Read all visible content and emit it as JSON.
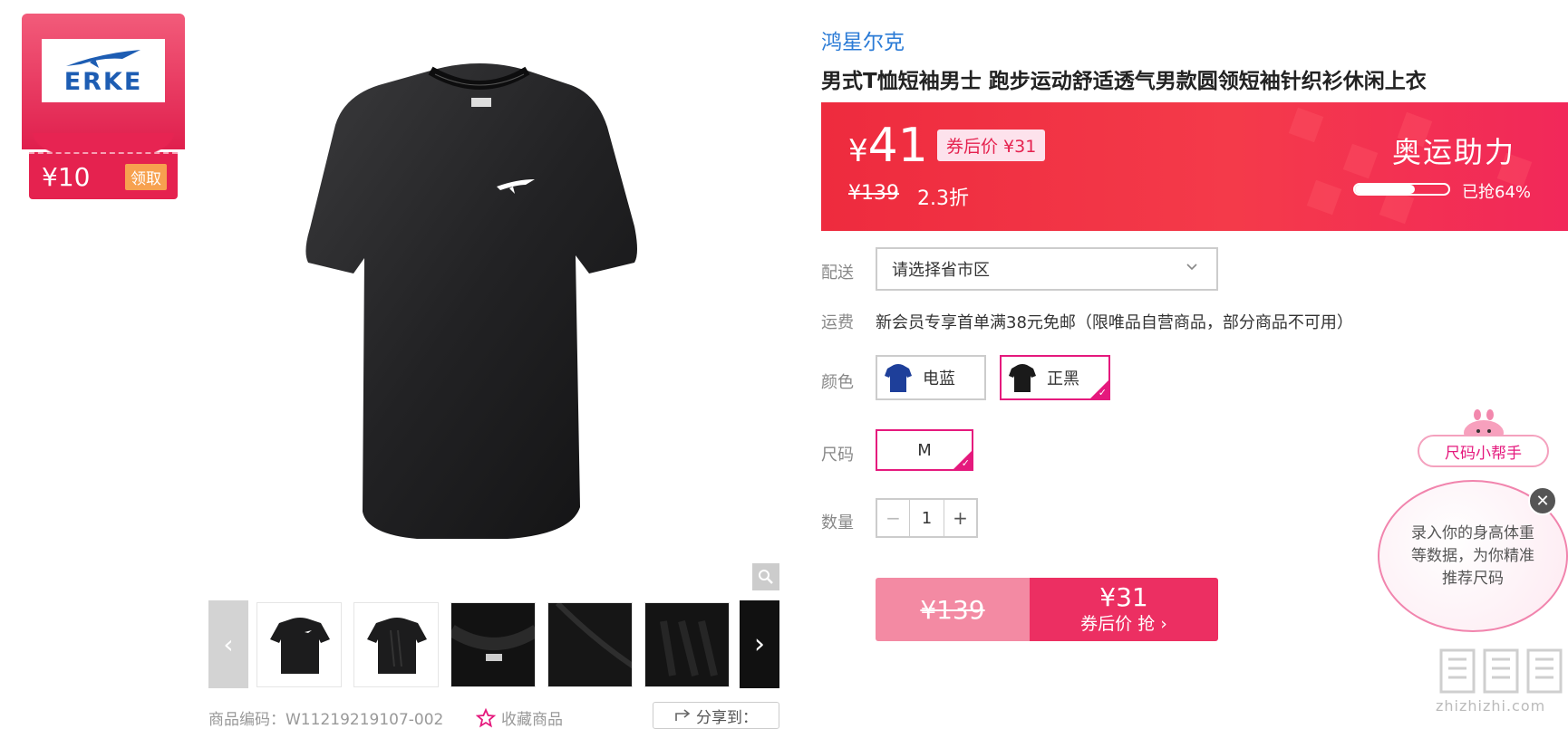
{
  "coupon": {
    "amount": "¥10",
    "claim_label": "领取",
    "logo_text": "ERKE"
  },
  "product": {
    "brand": "鸿星尔克",
    "title": "男式T恤短袖男士 跑步运动舒适透气男款圆领短袖针织衫休闲上衣",
    "sku_label": "商品编码：W11219219107-002",
    "favorite_label": "收藏商品",
    "share_label": "分享到："
  },
  "price": {
    "currency": "¥",
    "current": "41",
    "after_coupon_badge": "券后价 ¥31",
    "original": "¥139",
    "discount": "2.3折",
    "campaign": "奥运助力",
    "sold_percent": 64,
    "sold_text": "已抢64%"
  },
  "delivery": {
    "label": "配送",
    "placeholder": "请选择省市区"
  },
  "shipping": {
    "label": "运费",
    "text": "新会员专享首单满38元免邮（限唯品自营商品，部分商品不可用）"
  },
  "color": {
    "label": "颜色",
    "options": [
      {
        "name": "电蓝",
        "swatch": "#1e3f9a",
        "selected": false
      },
      {
        "name": "正黑",
        "swatch": "#1a1a1a",
        "selected": true
      }
    ]
  },
  "size": {
    "label": "尺码",
    "options": [
      {
        "name": "M",
        "selected": true
      }
    ]
  },
  "quantity": {
    "label": "数量",
    "value": "1",
    "minus": "−",
    "plus": "+"
  },
  "buy": {
    "original_price": "¥139",
    "coupon_price": "¥31",
    "coupon_label": "券后价 抢 ›"
  },
  "size_helper": {
    "title": "尺码小帮手",
    "message": "录入你的身高体重等数据，为你精准推荐尺码",
    "close": "✕"
  },
  "thumbs": {
    "prev": "‹",
    "next": "›"
  },
  "watermark": {
    "text": "zhizhizhi.com"
  },
  "colors": {
    "accent": "#e5197d",
    "price_red": "#ee2b3e",
    "brand_blue": "#2b7bd6"
  }
}
